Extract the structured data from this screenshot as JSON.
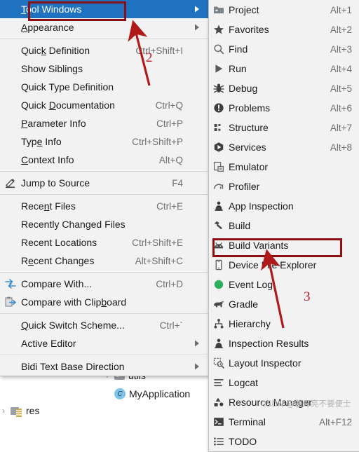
{
  "app": {
    "context": "Android Studio View menu — Tool Windows submenu open",
    "watermark": "CSDN @要月亮不要便士"
  },
  "colors": {
    "menu_bg": "#f2f2f2",
    "menu_border": "#c0c0c0",
    "selection_blue": "#1f72c0",
    "annotation_red": "#8c0f14",
    "annotation_number_red": "#c1121f",
    "shortcut_gray": "#6e6e6e"
  },
  "left_menu": {
    "name": "view-menu",
    "items": [
      {
        "label": "Tool Windows",
        "mnemonic": "T",
        "shortcut": "",
        "icon": "none",
        "submenu": true,
        "selected": true
      },
      {
        "label": "Appearance",
        "mnemonic": "A",
        "shortcut": "",
        "icon": "none",
        "submenu": true,
        "selected": false
      },
      {
        "separator": true
      },
      {
        "label": "Quick Definition",
        "mnemonic": "k",
        "shortcut": "Ctrl+Shift+I",
        "icon": "none",
        "submenu": false,
        "selected": false
      },
      {
        "label": "Show Siblings",
        "mnemonic": "",
        "shortcut": "",
        "icon": "none",
        "submenu": false,
        "selected": false
      },
      {
        "label": "Quick Type Definition",
        "mnemonic": "",
        "shortcut": "",
        "icon": "none",
        "submenu": false,
        "selected": false
      },
      {
        "label": "Quick Documentation",
        "mnemonic": "D",
        "shortcut": "Ctrl+Q",
        "icon": "none",
        "submenu": false,
        "selected": false
      },
      {
        "label": "Parameter Info",
        "mnemonic": "P",
        "shortcut": "Ctrl+P",
        "icon": "none",
        "submenu": false,
        "selected": false
      },
      {
        "label": "Type Info",
        "mnemonic": "e",
        "shortcut": "Ctrl+Shift+P",
        "icon": "none",
        "submenu": false,
        "selected": false
      },
      {
        "label": "Context Info",
        "mnemonic": "C",
        "shortcut": "Alt+Q",
        "icon": "none",
        "submenu": false,
        "selected": false
      },
      {
        "separator": true
      },
      {
        "label": "Jump to Source",
        "mnemonic": "",
        "shortcut": "F4",
        "icon": "pencil-icon",
        "submenu": false,
        "selected": false
      },
      {
        "separator": true
      },
      {
        "label": "Recent Files",
        "mnemonic": "n",
        "shortcut": "Ctrl+E",
        "icon": "none",
        "submenu": false,
        "selected": false
      },
      {
        "label": "Recently Changed Files",
        "mnemonic": "",
        "shortcut": "",
        "icon": "none",
        "submenu": false,
        "selected": false
      },
      {
        "label": "Recent Locations",
        "mnemonic": "",
        "shortcut": "Ctrl+Shift+E",
        "icon": "none",
        "submenu": false,
        "selected": false
      },
      {
        "label": "Recent Changes",
        "mnemonic": "e",
        "shortcut": "Alt+Shift+C",
        "icon": "none",
        "submenu": false,
        "selected": false
      },
      {
        "separator": true
      },
      {
        "label": "Compare With...",
        "mnemonic": "",
        "shortcut": "Ctrl+D",
        "icon": "compare-icon",
        "submenu": false,
        "selected": false
      },
      {
        "label": "Compare with Clipboard",
        "mnemonic": "b",
        "shortcut": "",
        "icon": "compare-clipboard-icon",
        "submenu": false,
        "selected": false
      },
      {
        "separator": true
      },
      {
        "label": "Quick Switch Scheme...",
        "mnemonic": "Q",
        "shortcut": "Ctrl+`",
        "icon": "none",
        "submenu": false,
        "selected": false
      },
      {
        "label": "Active Editor",
        "mnemonic": "",
        "shortcut": "",
        "icon": "none",
        "submenu": true,
        "selected": false
      },
      {
        "separator": true
      },
      {
        "label": "Bidi Text Base Direction",
        "mnemonic": "",
        "shortcut": "",
        "icon": "none",
        "submenu": true,
        "selected": false
      }
    ]
  },
  "right_menu": {
    "name": "tool-windows-submenu",
    "items": [
      {
        "label": "Project",
        "shortcut": "Alt+1",
        "icon": "folder-icon",
        "highlighted": false
      },
      {
        "label": "Favorites",
        "shortcut": "Alt+2",
        "icon": "star-icon",
        "highlighted": false
      },
      {
        "label": "Find",
        "shortcut": "Alt+3",
        "icon": "search-icon",
        "highlighted": false
      },
      {
        "label": "Run",
        "shortcut": "Alt+4",
        "icon": "play-icon",
        "highlighted": false
      },
      {
        "label": "Debug",
        "shortcut": "Alt+5",
        "icon": "bug-icon",
        "highlighted": false
      },
      {
        "label": "Problems",
        "shortcut": "Alt+6",
        "icon": "exclamation-circle-icon",
        "highlighted": false
      },
      {
        "label": "Structure",
        "shortcut": "Alt+7",
        "icon": "structure-icon",
        "highlighted": false
      },
      {
        "label": "Services",
        "shortcut": "Alt+8",
        "icon": "services-icon",
        "highlighted": false
      },
      {
        "label": "Emulator",
        "shortcut": "",
        "icon": "emulator-icon",
        "highlighted": false
      },
      {
        "label": "Profiler",
        "shortcut": "",
        "icon": "profiler-icon",
        "highlighted": false
      },
      {
        "label": "App Inspection",
        "shortcut": "",
        "icon": "app-inspection-icon",
        "highlighted": false
      },
      {
        "label": "Build",
        "shortcut": "",
        "icon": "hammer-icon",
        "highlighted": false
      },
      {
        "label": "Build Variants",
        "shortcut": "",
        "icon": "android-icon",
        "highlighted": false
      },
      {
        "label": "Device File Explorer",
        "shortcut": "",
        "icon": "device-icon",
        "highlighted": true
      },
      {
        "label": "Event Log",
        "shortcut": "",
        "icon": "event-log-icon",
        "highlighted": false
      },
      {
        "label": "Gradle",
        "shortcut": "",
        "icon": "gradle-elephant-icon",
        "highlighted": false
      },
      {
        "label": "Hierarchy",
        "shortcut": "",
        "icon": "hierarchy-icon",
        "highlighted": false
      },
      {
        "label": "Inspection Results",
        "shortcut": "",
        "icon": "inspection-icon",
        "highlighted": false
      },
      {
        "label": "Layout Inspector",
        "shortcut": "",
        "icon": "layout-inspector-icon",
        "highlighted": false
      },
      {
        "label": "Logcat",
        "shortcut": "",
        "icon": "logcat-icon",
        "highlighted": false
      },
      {
        "label": "Resource Manager",
        "shortcut": "",
        "icon": "resource-manager-icon",
        "highlighted": false
      },
      {
        "label": "Terminal",
        "shortcut": "Alt+F12",
        "icon": "terminal-icon",
        "highlighted": false
      },
      {
        "label": "TODO",
        "shortcut": "",
        "icon": "todo-list-icon",
        "highlighted": false
      }
    ]
  },
  "project_tree": {
    "name": "project-tree",
    "rows": [
      {
        "label": "utils",
        "icon": "folder-icon",
        "arrow": "›",
        "indent": 148
      },
      {
        "label": "MyApplication",
        "icon": "class-icon",
        "arrow": "",
        "indent": 148
      },
      {
        "label": "res",
        "icon": "res-folder-icon",
        "arrow": "›",
        "indent": 0
      }
    ]
  },
  "annotations": {
    "callout_2": "2",
    "callout_3": "3",
    "highlight_tool_windows": "Tool Windows",
    "highlight_device_file_explorer": "Device File Explorer"
  }
}
